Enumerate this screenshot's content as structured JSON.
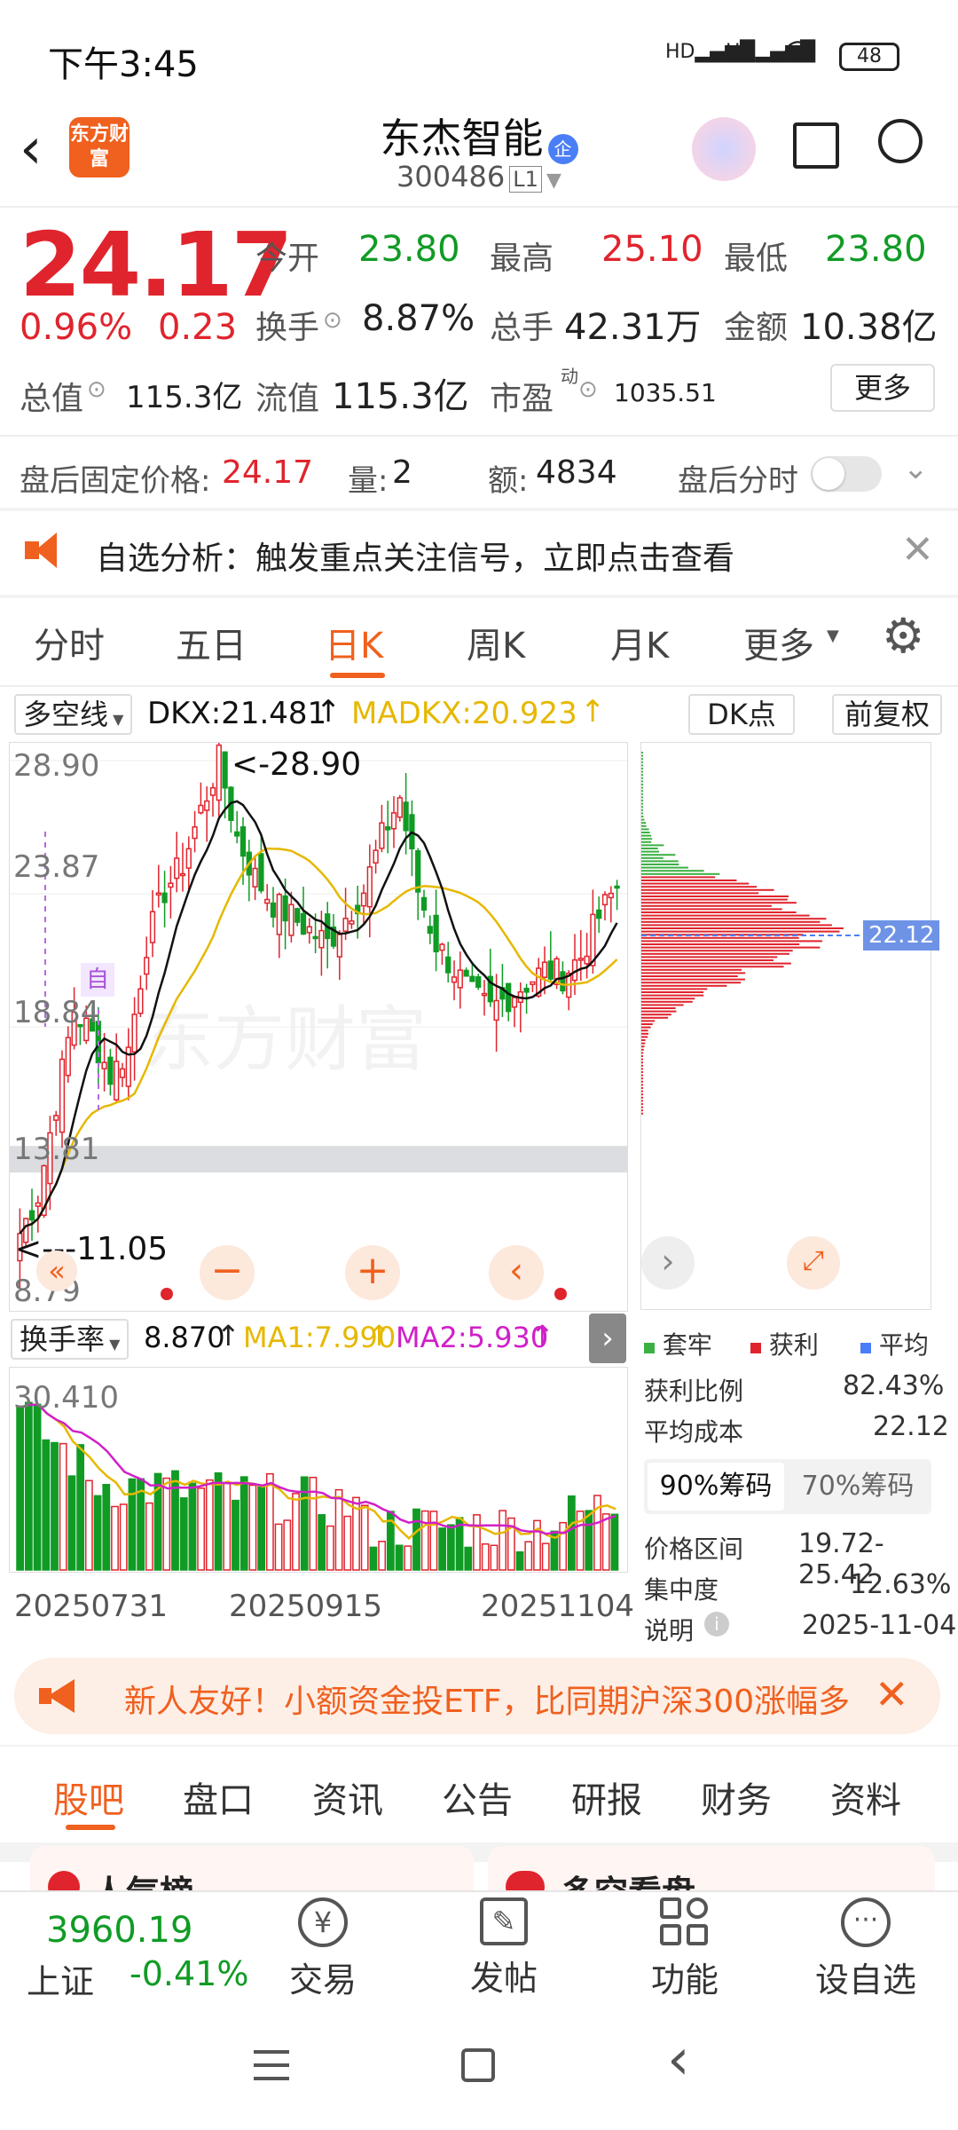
{
  "status": {
    "time": "下午3:45",
    "battery": "48"
  },
  "header": {
    "logo_text": "东方财富",
    "stock_name": "东杰智能",
    "badge": "企",
    "code": "300486",
    "level": "L1"
  },
  "quote": {
    "price": "24.17",
    "change_pct": "0.96%",
    "change_abs": "0.23",
    "open_label": "今开",
    "open": "23.80",
    "high_label": "最高",
    "high": "25.10",
    "low_label": "最低",
    "low": "23.80",
    "turnover_label": "换手",
    "turnover": "8.87%",
    "volume_label": "总手",
    "volume": "42.31万",
    "amount_label": "金额",
    "amount": "10.38亿",
    "mktcap_label": "总值",
    "mktcap": "115.3亿",
    "float_label": "流值",
    "float_cap": "115.3亿",
    "pe_label": "市盈",
    "pe_sup": "动",
    "pe": "1035.51",
    "more": "更多"
  },
  "after_hours": {
    "price_label": "盘后固定价格:",
    "price": "24.17",
    "vol_label": "量:",
    "vol": "2",
    "amt_label": "额:",
    "amt": "4834",
    "toggle_label": "盘后分时",
    "toggle_on": false
  },
  "notice": {
    "text": "自选分析：触发重点关注信号，立即点击查看"
  },
  "chart_tabs": {
    "items": [
      "分时",
      "五日",
      "日K",
      "周K",
      "月K",
      "更多"
    ],
    "active": "日K"
  },
  "indicator": {
    "name": "多空线",
    "dkx": "DKX:21.481",
    "madkx": "MADKX:20.923",
    "dk_btn": "DK点",
    "fq_btn": "前复权"
  },
  "main_chart": {
    "y_labels": [
      "28.90",
      "23.87",
      "18.84",
      "13.81",
      "8.79"
    ],
    "high_note": "<-28.90",
    "low_note": "<---11.05",
    "ytags": [
      "自"
    ],
    "watermark": "东方财富"
  },
  "chip": {
    "avg_tag": "22.12",
    "legend": [
      "套牢",
      "获利",
      "平均"
    ],
    "rows": [
      {
        "label": "获利比例",
        "value": "82.43%"
      },
      {
        "label": "平均成本",
        "value": "22.12"
      }
    ],
    "tabs": [
      "90%筹码",
      "70%筹码"
    ],
    "rows2": [
      {
        "label": "价格区间",
        "value": "19.72-25.42"
      },
      {
        "label": "集中度",
        "value": "12.63%"
      },
      {
        "label": "说明",
        "value": "2025-11-04"
      }
    ]
  },
  "sub_chart": {
    "name": "换手率",
    "val": "8.870",
    "ma1": "MA1:7.990",
    "ma2": "MA2:5.930",
    "y_label": "30.410",
    "dates": [
      "20250731",
      "20250915",
      "20251104"
    ]
  },
  "promo": {
    "text": "新人友好！小额资金投ETF，比同期沪深300涨幅多"
  },
  "bottom_tabs": {
    "items": [
      "股吧",
      "盘口",
      "资讯",
      "公告",
      "研报",
      "财务",
      "资料"
    ],
    "active": "股吧"
  },
  "peek": {
    "left": "人气榜",
    "right": "多空看盘"
  },
  "bottom_nav": {
    "index_value": "3960.19",
    "index_name": "上证",
    "index_change": "-0.41%",
    "items": [
      "交易",
      "发帖",
      "功能",
      "设自选"
    ]
  },
  "colors": {
    "up": "#e0242d",
    "down": "#109b25",
    "accent": "#f0601e",
    "madkx": "#e6b800",
    "ma2": "#d020c8"
  },
  "chart_data": [
    {
      "type": "candlestick",
      "title": "日K",
      "ylim": [
        8.79,
        28.9
      ],
      "high_marker": 28.9,
      "low_marker": 11.05,
      "avg_cost": 22.12,
      "close_trend": [
        11.05,
        12.5,
        16,
        19.5,
        18.5,
        17,
        18,
        22,
        24,
        25,
        27,
        28.9,
        26,
        24.5,
        23.5,
        23,
        22.5,
        22,
        23,
        24,
        26,
        27.5,
        24,
        22,
        21,
        20,
        19.5,
        20,
        20.5,
        21,
        20.8,
        21.5,
        23,
        24.17
      ],
      "series": [
        {
          "name": "DKX",
          "value": 21.481
        },
        {
          "name": "MADKX",
          "value": 20.923
        }
      ]
    },
    {
      "type": "bar",
      "title": "换手率",
      "ylim": [
        0,
        30.41
      ],
      "series": [
        {
          "name": "换手率",
          "value": 8.87
        },
        {
          "name": "MA1",
          "value": 7.99
        },
        {
          "name": "MA2",
          "value": 5.93
        }
      ],
      "x_ticks": [
        "20250731",
        "20250915",
        "20251104"
      ]
    }
  ]
}
